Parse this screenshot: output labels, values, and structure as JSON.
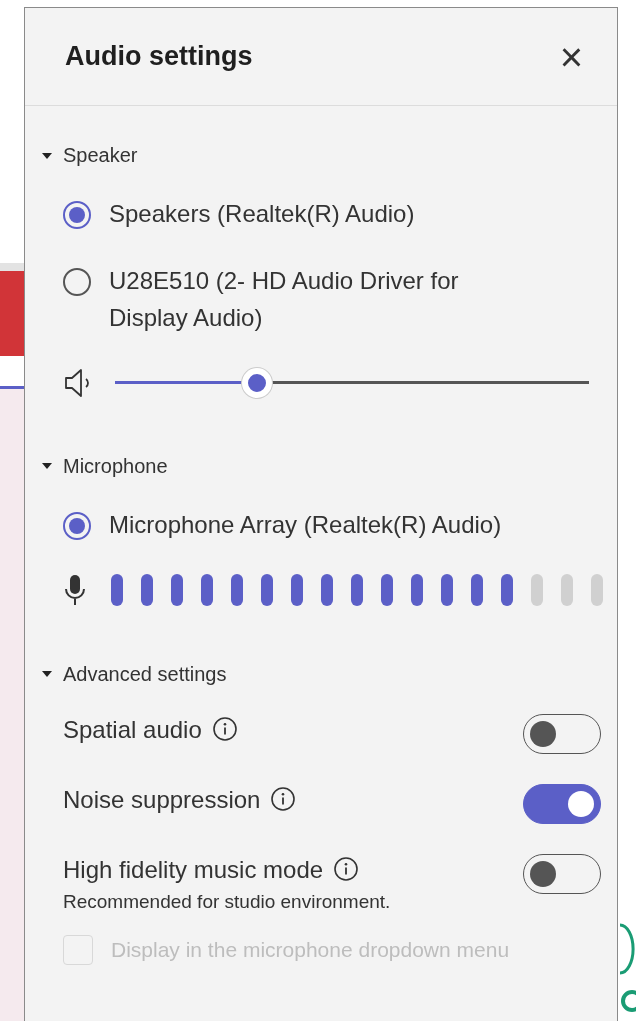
{
  "panel": {
    "title": "Audio settings",
    "close": "×"
  },
  "sections": [
    {
      "label": "Speaker",
      "expanded": true,
      "items": [
        {
          "kind": "radio",
          "label": "Speakers (Realtek(R) Audio)",
          "selected": true
        },
        {
          "kind": "radio",
          "label": "U28E510 (2- HD Audio Driver for Display Audio)",
          "selected": false
        },
        {
          "kind": "slider",
          "level": 0.3
        }
      ]
    },
    {
      "label": "Microphone",
      "expanded": true,
      "items": [
        {
          "kind": "radio",
          "label": "Microphone Array (Realtek(R) Audio)",
          "selected": true
        },
        {
          "kind": "meter",
          "level": 0.82
        }
      ]
    },
    {
      "label": "Advanced settings",
      "expanded": true,
      "items": [
        {
          "kind": "toggle",
          "label": "Spatial audio",
          "on": false
        },
        {
          "kind": "toggle",
          "label": "Noise suppression",
          "on": true
        },
        {
          "kind": "toggle",
          "label": "High fidelity music mode",
          "on": false,
          "note": "Recommended for studio environment."
        },
        {
          "kind": "checkbox",
          "label": "Display in the microphone dropdown menu",
          "checked": false,
          "disabled": true
        }
      ]
    }
  ]
}
